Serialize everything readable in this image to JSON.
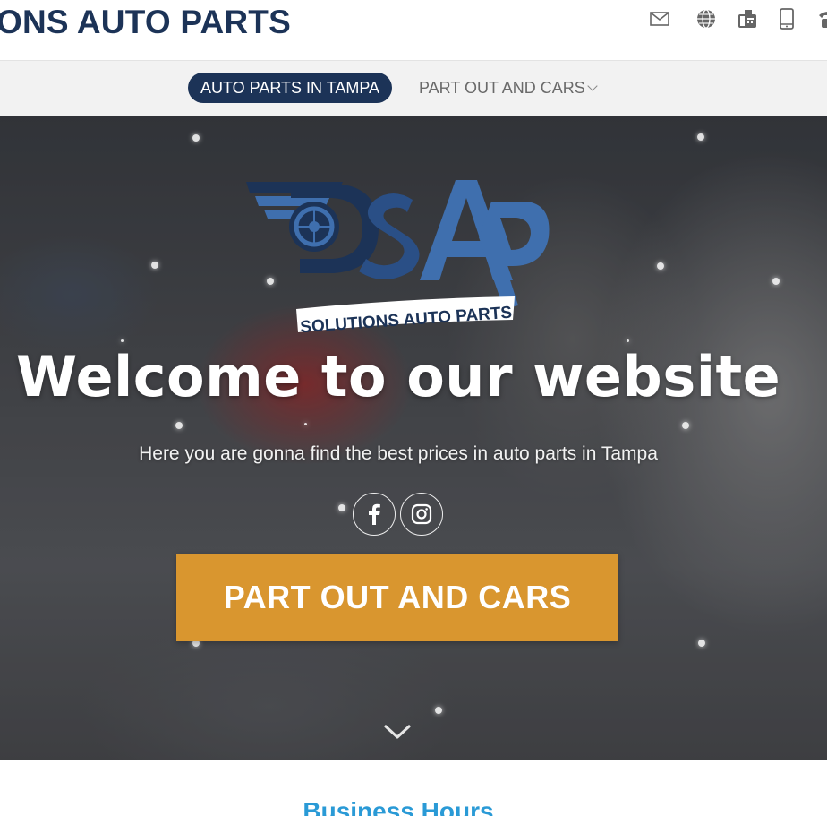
{
  "header": {
    "brand": "ONS AUTO PARTS",
    "icons": [
      "envelope-icon",
      "globe-icon",
      "fax-icon",
      "mobile-phone-icon",
      "phone-icon"
    ]
  },
  "nav": {
    "items": [
      {
        "label": "AUTO PARTS IN TAMPA",
        "active": true
      },
      {
        "label": "PART OUT AND CARS",
        "dropdown": true
      }
    ]
  },
  "hero": {
    "logo_text": "SOLUTIONS AUTO PARTS",
    "title": "Welcome to our website",
    "subtitle": "Here you are gonna find the best prices in auto parts in Tampa",
    "social": [
      "facebook-icon",
      "instagram-icon"
    ],
    "cta_label": "PART OUT AND CARS"
  },
  "next_section": {
    "title": "Business Hours"
  },
  "colors": {
    "brand_navy": "#1c3357",
    "cta_orange": "#d9962f",
    "section_blue": "#2a9ad6",
    "logo_blue": "#3f6fae"
  }
}
